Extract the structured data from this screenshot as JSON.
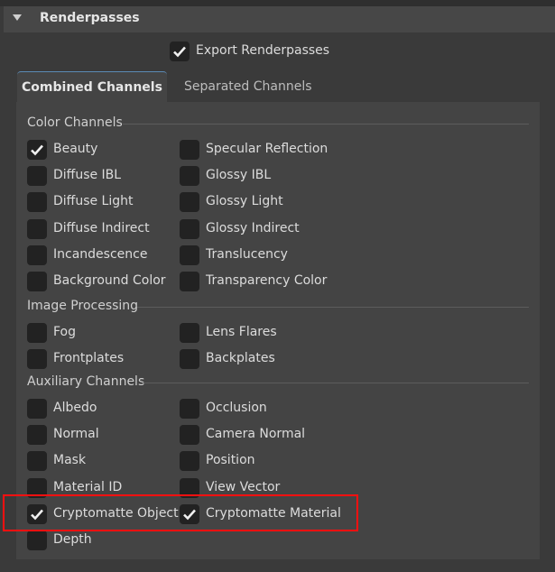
{
  "section_title": "Renderpasses",
  "export": {
    "label": "Export Renderpasses",
    "checked": true
  },
  "tabs": [
    {
      "label": "Combined Channels",
      "active": true
    },
    {
      "label": "Separated Channels",
      "active": false
    }
  ],
  "groups": [
    {
      "title": "Color Channels",
      "items": [
        {
          "label": "Beauty",
          "checked": true
        },
        {
          "label": "Specular Reflection",
          "checked": false
        },
        {
          "label": "Diffuse IBL",
          "checked": false
        },
        {
          "label": "Glossy IBL",
          "checked": false
        },
        {
          "label": "Diffuse Light",
          "checked": false
        },
        {
          "label": "Glossy Light",
          "checked": false
        },
        {
          "label": "Diffuse Indirect",
          "checked": false
        },
        {
          "label": "Glossy Indirect",
          "checked": false
        },
        {
          "label": "Incandescence",
          "checked": false
        },
        {
          "label": "Translucency",
          "checked": false
        },
        {
          "label": "Background Color",
          "checked": false
        },
        {
          "label": "Transparency Color",
          "checked": false
        }
      ]
    },
    {
      "title": "Image Processing",
      "items": [
        {
          "label": "Fog",
          "checked": false
        },
        {
          "label": "Lens Flares",
          "checked": false
        },
        {
          "label": "Frontplates",
          "checked": false
        },
        {
          "label": "Backplates",
          "checked": false
        }
      ]
    },
    {
      "title": "Auxiliary Channels",
      "items": [
        {
          "label": "Albedo",
          "checked": false
        },
        {
          "label": "Occlusion",
          "checked": false
        },
        {
          "label": "Normal",
          "checked": false
        },
        {
          "label": "Camera Normal",
          "checked": false
        },
        {
          "label": "Mask",
          "checked": false
        },
        {
          "label": "Position",
          "checked": false
        },
        {
          "label": "Material ID",
          "checked": false
        },
        {
          "label": "View Vector",
          "checked": false
        },
        {
          "label": "Cryptomatte Object",
          "checked": true
        },
        {
          "label": "Cryptomatte Material",
          "checked": true
        },
        {
          "label": "Depth",
          "checked": false
        }
      ]
    }
  ]
}
